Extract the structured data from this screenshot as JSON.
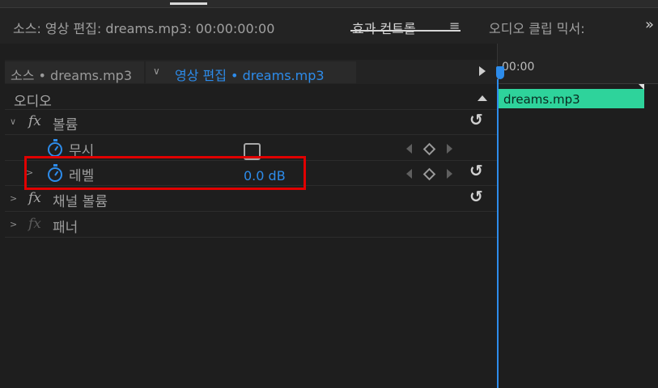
{
  "panel_tabs": {
    "source": "소스: 영상 편집: dreams.mp3: 00:00:00:00",
    "effect_controls": "효과 컨트롤",
    "menu_glyph": "≡",
    "audio_mixer": "오디오 클립 믹서:",
    "overflow_glyph": "»"
  },
  "clip_header": {
    "source_clip": "소스 • dreams.mp3",
    "sequence_clip": "영상 편집 • dreams.mp3"
  },
  "audio_section": {
    "label": "오디오"
  },
  "effects": [
    {
      "name": "볼륨",
      "icon": "fx-icon",
      "expanded": true
    },
    {
      "name": "채널 볼륨",
      "icon": "fx-icon",
      "expanded": false
    },
    {
      "name": "패너",
      "icon": "fx-icon",
      "expanded": false
    }
  ],
  "properties": {
    "bypass": {
      "label": "무시",
      "checked": false
    },
    "level": {
      "label": "레벨",
      "value": "0.0 dB"
    }
  },
  "timeline": {
    "timecode": "00:00",
    "clip_name": "dreams.mp3"
  },
  "colors": {
    "accent": "#2d8ceb",
    "clip": "#2ed39b",
    "highlight": "#e00000",
    "background": "#1e1e1e"
  }
}
